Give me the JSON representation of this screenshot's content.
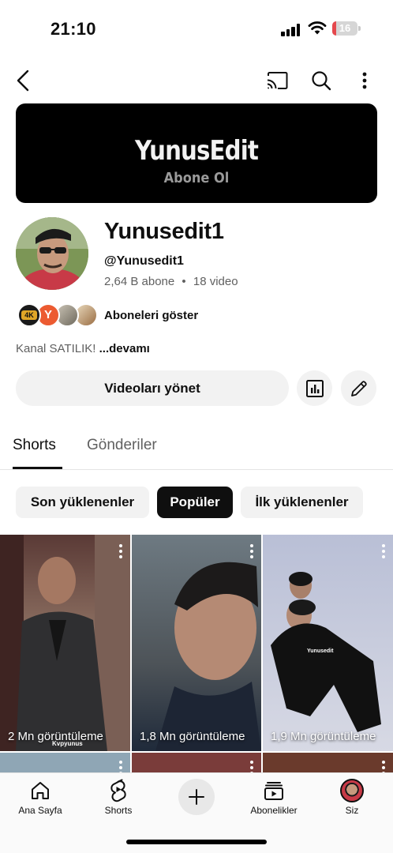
{
  "status_bar": {
    "time": "21:10",
    "battery": "16",
    "battery_level": 0.16
  },
  "banner": {
    "title": "YunusEdit",
    "subtitle": "Abone Ol"
  },
  "channel": {
    "name": "Yunusedit1",
    "handle": "@Yunusedit1",
    "subscribers": "2,64 B abone",
    "separator": "•",
    "videos": "18 video",
    "show_subscribers": "Aboneleri göster",
    "description": "Kanal SATILIK!",
    "more": "...devamı",
    "mini_avatar_letter": "Y",
    "mini_avatar_badge": "4K"
  },
  "actions": {
    "manage_videos": "Videoları yönet"
  },
  "tabs": [
    {
      "label": "Shorts",
      "active": true
    },
    {
      "label": "Gönderiler",
      "active": false
    }
  ],
  "filters": [
    {
      "label": "Son yüklenenler",
      "selected": false
    },
    {
      "label": "Popüler",
      "selected": true
    },
    {
      "label": "İlk yüklenenler",
      "selected": false
    }
  ],
  "shorts": [
    {
      "views": "2 Mn görüntüleme",
      "overlay_text": "Kvpyunus"
    },
    {
      "views": "1,8 Mn görüntüleme",
      "overlay_text": ""
    },
    {
      "views": "1,9 Mn görüntüleme",
      "overlay_text": "Yunusedit"
    }
  ],
  "bottom_nav": [
    {
      "label": "Ana Sayfa",
      "icon": "home-icon"
    },
    {
      "label": "Shorts",
      "icon": "shorts-icon"
    },
    {
      "label": "",
      "icon": "create-icon"
    },
    {
      "label": "Abonelikler",
      "icon": "subscriptions-icon"
    },
    {
      "label": "Siz",
      "icon": "profile-avatar"
    }
  ],
  "colors": {
    "accent_dark": "#0f0f0f",
    "chip_bg": "#f2f2f2",
    "muted_text": "#606060",
    "battery_low": "#e5484d"
  }
}
